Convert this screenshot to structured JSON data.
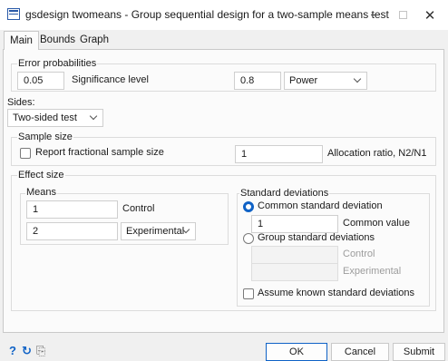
{
  "window": {
    "title": "gsdesign twomeans - Group sequential design for a two-sample means test"
  },
  "tabs": [
    {
      "label": "Main",
      "active": true
    },
    {
      "label": "Bounds",
      "active": false
    },
    {
      "label": "Graph",
      "active": false
    }
  ],
  "error_probabilities": {
    "legend": "Error probabilities",
    "significance_value": "0.05",
    "significance_label": "Significance level",
    "power_value": "0.8",
    "power_select": "Power"
  },
  "sides": {
    "label": "Sides:",
    "selected": "Two-sided test"
  },
  "sample_size": {
    "legend": "Sample size",
    "fractional_label": "Report fractional sample size",
    "fractional_checked": false,
    "allocation_value": "1",
    "allocation_label": "Allocation ratio, N2/N1"
  },
  "effect_size": {
    "legend": "Effect size",
    "means": {
      "legend": "Means",
      "control_value": "1",
      "control_label": "Control",
      "experimental_value": "2",
      "experimental_select": "Experimental"
    },
    "std": {
      "legend": "Standard deviations",
      "common_label": "Common standard deviation",
      "common_selected": true,
      "common_value": "1",
      "common_value_label": "Common value",
      "group_label": "Group standard deviations",
      "group_selected": false,
      "control_label": "Control",
      "experimental_label": "Experimental",
      "assume_known_label": "Assume known standard deviations",
      "assume_known_checked": false
    }
  },
  "buttons": {
    "ok": "OK",
    "cancel": "Cancel",
    "submit": "Submit"
  },
  "icons": {
    "help": "?",
    "reset": "↻",
    "copy": "⎘"
  },
  "colors": {
    "accent": "#0f62c6"
  }
}
